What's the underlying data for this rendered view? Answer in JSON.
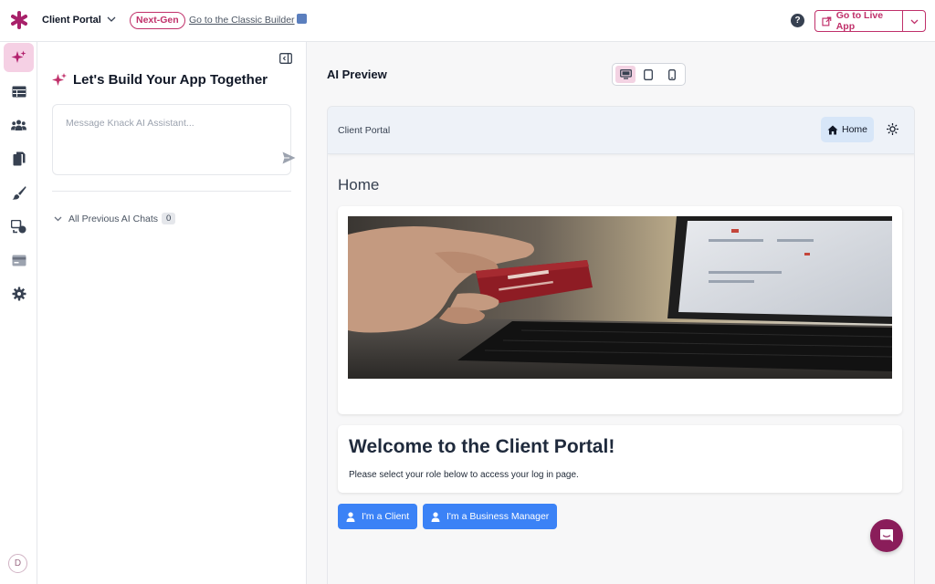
{
  "topbar": {
    "app_name": "Client Portal",
    "badge": "Next-Gen",
    "classic_link": "Go to the Classic Builder",
    "help": "?",
    "live_button": "Go to Live App",
    "brand_color": "#c0306a"
  },
  "rail": {
    "items": [
      {
        "name": "ai-sparkle-icon",
        "active": true
      },
      {
        "name": "table-icon"
      },
      {
        "name": "users-icon"
      },
      {
        "name": "pages-icon"
      },
      {
        "name": "brush-icon"
      },
      {
        "name": "flows-icon"
      },
      {
        "name": "billing-icon"
      },
      {
        "name": "gear-icon"
      }
    ],
    "avatar_initial": "D"
  },
  "chat": {
    "title": "Let's Build Your App Together",
    "input_placeholder": "Message Knack AI Assistant...",
    "previous_label": "All Previous AI Chats",
    "previous_count": "0"
  },
  "preview": {
    "title": "AI Preview",
    "devices": [
      "desktop",
      "tablet",
      "mobile"
    ],
    "active_device": "desktop",
    "app": {
      "header_title": "Client Portal",
      "home_label": "Home",
      "page_title": "Home",
      "welcome_title": "Welcome to the Client Portal!",
      "welcome_sub": "Please select your role below to access your log in page.",
      "role_buttons": [
        "I'm a Client",
        "I'm a Business Manager"
      ],
      "button_color": "#3b82f6"
    }
  }
}
